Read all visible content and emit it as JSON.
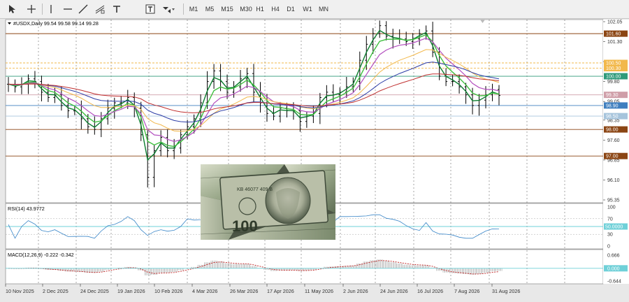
{
  "toolbar": {
    "timeframes": [
      "M1",
      "M5",
      "M15",
      "M30",
      "H1",
      "H4",
      "D1",
      "W1",
      "MN"
    ],
    "tools": [
      "cursor-icon",
      "crosshair-icon",
      "vertical-line-icon",
      "horizontal-line-icon",
      "trendline-icon",
      "fibonacci-channel-icon",
      "text-icon",
      "text-label-icon",
      "arrow-shapes-icon"
    ]
  },
  "chart_data": [
    {
      "type": "line",
      "title": "#USDX,Daily  99.54 99.58 99.14 99.28",
      "x_ticks": [
        "10 Nov 2025",
        "2 Dec 2025",
        "24 Dec 2025",
        "19 Jan 2026",
        "10 Feb 2026",
        "4 Mar 2026",
        "26 Mar 2026",
        "17 Apr 2026",
        "11 May 2026",
        "2 Jun 2026",
        "24 Jun 2026",
        "16 Jul 2026",
        "7 Aug 2026",
        "31 Aug 2026"
      ],
      "y_ticks": [
        "102.05",
        "101.30",
        "100.55",
        "99.80",
        "99.05",
        "98.35",
        "97.60",
        "96.85",
        "96.10",
        "95.35"
      ],
      "ylim": [
        95.35,
        102.05
      ],
      "series": [
        {
          "values": [
            99.7,
            99.6,
            99.7,
            99.9,
            99.8,
            99.4,
            99.2,
            99.3,
            98.9,
            98.7,
            98.7,
            98.4,
            98.1,
            98.0,
            98.4,
            98.8,
            99.0,
            99.0,
            99.2,
            98.8,
            97.8,
            96.2,
            97.2,
            97.7,
            97.2,
            97.3,
            97.8,
            98.1,
            98.4,
            99.0,
            99.8,
            100.2,
            99.8,
            99.4,
            99.6,
            99.9,
            100.1,
            99.4,
            99.0,
            98.6,
            98.5,
            98.8,
            98.7,
            98.7,
            98.3,
            98.5,
            98.6,
            99.2,
            99.4,
            99.3,
            99.4,
            99.6,
            99.8,
            100.6,
            101.2,
            101.6,
            101.9,
            101.5,
            101.4,
            101.4,
            101.3,
            101.4,
            101.6,
            101.7,
            100.9,
            100.0,
            99.8,
            99.8,
            99.6,
            99.3,
            98.9,
            99.1,
            99.3,
            99.5,
            99.28
          ]
        }
      ],
      "price_labels": [
        {
          "value": "101.60",
          "color": "#8b4513"
        },
        {
          "value": "100.50",
          "color": "#f2b84b"
        },
        {
          "value": "100.30",
          "color": "#f2b84b"
        },
        {
          "value": "100.00",
          "color": "#2e9a7a"
        },
        {
          "value": "99.30",
          "color": "#cf9ea8"
        },
        {
          "value": "98.90",
          "color": "#3f7fbf"
        },
        {
          "value": "98.50",
          "color": "#a6c4dc"
        },
        {
          "value": "98.00",
          "color": "#8b4513"
        },
        {
          "value": "97.00",
          "color": "#8b4513"
        }
      ]
    },
    {
      "type": "line",
      "title": "RSI(14) 43.9772",
      "y_ticks": [
        "100",
        "70",
        "50",
        "30",
        "0"
      ],
      "ylim": [
        0,
        100
      ],
      "level_label": "50.0000",
      "accent": "#3a86c8"
    },
    {
      "type": "bar",
      "title": "MACD(12,26,9) -0.222 -0.342",
      "y_ticks": [
        "0.666",
        "0.000",
        "-0.644"
      ],
      "ylim": [
        -0.644,
        0.666
      ],
      "zero_label": "0.000"
    }
  ]
}
